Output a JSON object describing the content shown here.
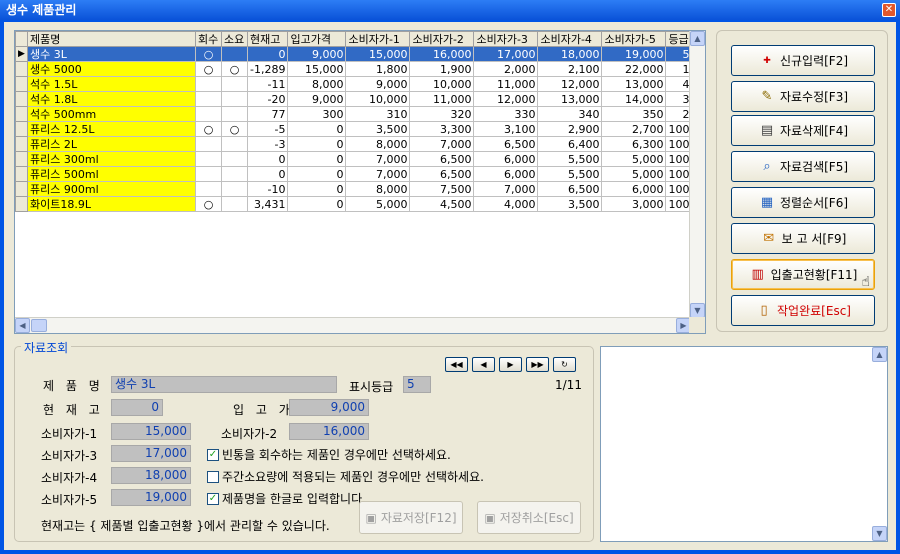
{
  "window": {
    "title": "생수 제품관리",
    "close_glyph": "✕"
  },
  "grid": {
    "columns": [
      "제품명",
      "회수",
      "소요",
      "현재고",
      "입고가격",
      "소비자가-1",
      "소비자가-2",
      "소비자가-3",
      "소비자가-4",
      "소비자가-5",
      "등급"
    ],
    "rows": [
      {
        "name": "생수 3L",
        "ret": "○",
        "use": "",
        "stock": "0",
        "inp": "9,000",
        "p1": "15,000",
        "p2": "16,000",
        "p3": "17,000",
        "p4": "18,000",
        "p5": "19,000",
        "grade": "5"
      },
      {
        "name": "생수 5000",
        "ret": "○",
        "use": "○",
        "stock": "-1,289",
        "inp": "15,000",
        "p1": "1,800",
        "p2": "1,900",
        "p3": "2,000",
        "p4": "2,100",
        "p5": "22,000",
        "grade": "1"
      },
      {
        "name": "석수 1.5L",
        "ret": "",
        "use": "",
        "stock": "-11",
        "inp": "8,000",
        "p1": "9,000",
        "p2": "10,000",
        "p3": "11,000",
        "p4": "12,000",
        "p5": "13,000",
        "grade": "4"
      },
      {
        "name": "석수 1.8L",
        "ret": "",
        "use": "",
        "stock": "-20",
        "inp": "9,000",
        "p1": "10,000",
        "p2": "11,000",
        "p3": "12,000",
        "p4": "13,000",
        "p5": "14,000",
        "grade": "3"
      },
      {
        "name": "석수 500mm",
        "ret": "",
        "use": "",
        "stock": "77",
        "inp": "300",
        "p1": "310",
        "p2": "320",
        "p3": "330",
        "p4": "340",
        "p5": "350",
        "grade": "2"
      },
      {
        "name": "퓨리스 12.5L",
        "ret": "○",
        "use": "○",
        "stock": "-5",
        "inp": "0",
        "p1": "3,500",
        "p2": "3,300",
        "p3": "3,100",
        "p4": "2,900",
        "p5": "2,700",
        "grade": "100"
      },
      {
        "name": "퓨리스 2L",
        "ret": "",
        "use": "",
        "stock": "-3",
        "inp": "0",
        "p1": "8,000",
        "p2": "7,000",
        "p3": "6,500",
        "p4": "6,400",
        "p5": "6,300",
        "grade": "100"
      },
      {
        "name": "퓨리스 300ml",
        "ret": "",
        "use": "",
        "stock": "0",
        "inp": "0",
        "p1": "7,000",
        "p2": "6,500",
        "p3": "6,000",
        "p4": "5,500",
        "p5": "5,000",
        "grade": "100"
      },
      {
        "name": "퓨리스 500ml",
        "ret": "",
        "use": "",
        "stock": "0",
        "inp": "0",
        "p1": "7,000",
        "p2": "6,500",
        "p3": "6,000",
        "p4": "5,500",
        "p5": "5,000",
        "grade": "100"
      },
      {
        "name": "퓨리스 900ml",
        "ret": "",
        "use": "",
        "stock": "-10",
        "inp": "0",
        "p1": "8,000",
        "p2": "7,500",
        "p3": "7,000",
        "p4": "6,500",
        "p5": "6,000",
        "grade": "100"
      },
      {
        "name": "화이트18.9L",
        "ret": "○",
        "use": "",
        "stock": "3,431",
        "inp": "0",
        "p1": "5,000",
        "p2": "4,500",
        "p3": "4,000",
        "p4": "3,500",
        "p5": "3,000",
        "grade": "100"
      }
    ]
  },
  "buttons": {
    "new": "신규입력[F2]",
    "edit": "자료수정[F3]",
    "delete": "자료삭제[F4]",
    "search": "자료검색[F5]",
    "sort": "정렬순서[F6]",
    "report": "보 고 서[F9]",
    "inout": "입출고현황[F11]",
    "done": "작업완료[Esc]"
  },
  "detail": {
    "legend": "자료조회",
    "labels": {
      "name": "제 품 명",
      "grade": "표시등급",
      "stock": "현 재 고",
      "inprice": "입 고 가",
      "p1": "소비자가-1",
      "p2": "소비자가-2",
      "p3": "소비자가-3",
      "p4": "소비자가-4",
      "p5": "소비자가-5"
    },
    "values": {
      "name": "생수 3L",
      "grade": "5",
      "stock": "0",
      "inprice": "9,000",
      "p1": "15,000",
      "p2": "16,000",
      "p3": "17,000",
      "p4": "18,000",
      "p5": "19,000"
    },
    "record_counter": "1/11",
    "checkboxes": {
      "returnable": "빈통을 회수하는 제품인 경우에만 선택하세요.",
      "weekly": "주간소요량에 적용되는 제품인 경우에만 선택하세요.",
      "korean": "제품명을 한글로 입력합니다."
    },
    "note": "현재고는 { 제품별 입출고현황 }에서 관리할 수 있습니다.",
    "save": "자료저장[F12]",
    "cancel": "저장취소[Esc]"
  }
}
